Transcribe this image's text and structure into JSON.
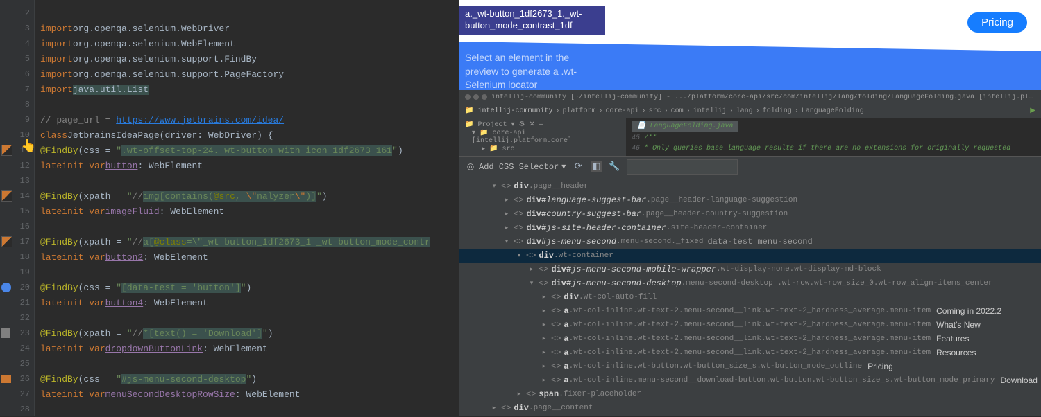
{
  "gutter": {
    "lines": [
      2,
      3,
      4,
      5,
      6,
      7,
      8,
      9,
      10,
      11,
      12,
      13,
      14,
      15,
      16,
      17,
      18,
      19,
      20,
      21,
      22,
      23,
      24,
      25,
      26,
      27,
      28
    ]
  },
  "code": {
    "imports": [
      "org.openqa.selenium.WebDriver",
      "org.openqa.selenium.WebElement",
      "org.openqa.selenium.support.FindBy",
      "org.openqa.selenium.support.PageFactory",
      "java.util.List"
    ],
    "page_url_comment": "// page_url = ",
    "page_url": "https://www.jetbrains.com/idea/",
    "class_decl": "JetbrainsIdeaPage",
    "driver_param": "driver: WebDriver",
    "findby1_css": ".wt-offset-top-24._wt-button_with_icon_1df2673_161",
    "field1": "button",
    "type1": "WebElement",
    "findby2_xpath_pre": "//",
    "findby2_xpath_img": "img[contains(",
    "findby2_attr": "@src",
    "findby2_val": "\\\"nalyzer\\\"",
    "findby2_post": ")]",
    "field2": "imageFluid",
    "findby3_xpath": "//",
    "findby3_a": "a[",
    "findby3_attr": "@class",
    "findby3_val": "=\\\"_wt-button_1df2673_1 _wt-button_mode_contr",
    "field3": "button2",
    "findby4_css": "[data-test = 'button']",
    "field4": "button4",
    "findby5_xpath": "//*[text() = ",
    "findby5_val": "'Download'",
    "findby5_post": "]",
    "field5": "dropdownButtonLink",
    "findby6_css": "#js-menu-second-desktop",
    "field6": "menuSecondDesktopRowSize",
    "lateinit": "lateinit var",
    "import_kw": "import",
    "class_kw": "class",
    "findby_annot": "@FindBy",
    "css_key": "css",
    "xpath_key": "xpath"
  },
  "preview": {
    "tooltip": "a._wt-button_1df2673_1._wt-button_mode_contrast_1df",
    "pricing": "Pricing",
    "text1": "Select an element in the",
    "text2": "preview to generate a .wt-",
    "text3": "Selenium locator"
  },
  "ide": {
    "title": "intellij-community [~/intellij-community] - .../platform/core-api/src/com/intellij/lang/folding/LanguageFolding.java [intellij.platform.core]",
    "crumbs": [
      "intellij-community",
      "platform",
      "core-api",
      "src",
      "com",
      "intellij",
      "lang",
      "folding",
      "LanguageFolding"
    ],
    "tab": "LanguageFolding.java",
    "project_label": "Project",
    "module": "core-api [intellij.platform.core]",
    "src": "src",
    "comment": "* Only queries base language results if there are no extensions for originally requested",
    "line1": "45",
    "line2": "46"
  },
  "toolbar": {
    "add_selector": "Add CSS Selector",
    "search_placeholder": ""
  },
  "tree": [
    {
      "indent": 2,
      "arrow": "▾",
      "tag": "div",
      "cls": ".page__header",
      "sel": false
    },
    {
      "indent": 3,
      "arrow": "▸",
      "tag": "div#",
      "id": "language-suggest-bar",
      "cls": ".page__header-language-suggestion",
      "sel": false
    },
    {
      "indent": 3,
      "arrow": "▸",
      "tag": "div#",
      "id": "country-suggest-bar",
      "cls": ".page__header-country-suggestion",
      "sel": false
    },
    {
      "indent": 3,
      "arrow": "▸",
      "tag": "div#",
      "id": "js-site-header-container",
      "cls": ".site-header-container",
      "sel": false
    },
    {
      "indent": 3,
      "arrow": "▾",
      "tag": "div#",
      "id": "js-menu-second",
      "cls": ".menu-second._fixed",
      "extra": "data-test=menu-second",
      "sel": false
    },
    {
      "indent": 4,
      "arrow": "▾",
      "tag": "div",
      "cls": ".wt-container",
      "sel": true
    },
    {
      "indent": 5,
      "arrow": "▸",
      "tag": "div#",
      "id": "js-menu-second-mobile-wrapper",
      "cls": ".wt-display-none.wt-display-md-block",
      "sel": false
    },
    {
      "indent": 5,
      "arrow": "▾",
      "tag": "div#",
      "id": "js-menu-second-desktop",
      "cls": ".menu-second-desktop .wt-row.wt-row_size_0.wt-row_align-items_center",
      "sel": false
    },
    {
      "indent": 6,
      "arrow": "▸",
      "tag": "div",
      "cls": ".wt-col-auto-fill",
      "sel": false
    },
    {
      "indent": 6,
      "arrow": "▸",
      "tag": "a",
      "cls": ".wt-col-inline.wt-text-2.menu-second__link.wt-text-2_hardness_average.menu-item",
      "label": "Coming in 2022.2",
      "sel": false
    },
    {
      "indent": 6,
      "arrow": "▸",
      "tag": "a",
      "cls": ".wt-col-inline.wt-text-2.menu-second__link.wt-text-2_hardness_average.menu-item",
      "label": "What's New",
      "sel": false
    },
    {
      "indent": 6,
      "arrow": "▸",
      "tag": "a",
      "cls": ".wt-col-inline.wt-text-2.menu-second__link.wt-text-2_hardness_average.menu-item",
      "label": "Features",
      "sel": false
    },
    {
      "indent": 6,
      "arrow": "▸",
      "tag": "a",
      "cls": ".wt-col-inline.wt-text-2.menu-second__link.wt-text-2_hardness_average.menu-item",
      "label": "Resources",
      "sel": false
    },
    {
      "indent": 6,
      "arrow": "▸",
      "tag": "a",
      "cls": ".wt-col-inline.wt-button.wt-button_size_s.wt-button_mode_outline",
      "label": "Pricing",
      "sel": false
    },
    {
      "indent": 6,
      "arrow": "▸",
      "tag": "a",
      "cls": ".wt-col-inline.menu-second__download-button.wt-button.wt-button_size_s.wt-button_mode_primary",
      "label": "Download",
      "sel": false
    },
    {
      "indent": 4,
      "arrow": "▸",
      "tag": "span",
      "cls": ".fixer-placeholder",
      "sel": false
    },
    {
      "indent": 2,
      "arrow": "▸",
      "tag": "div",
      "cls": ".page__content",
      "sel": false
    }
  ]
}
